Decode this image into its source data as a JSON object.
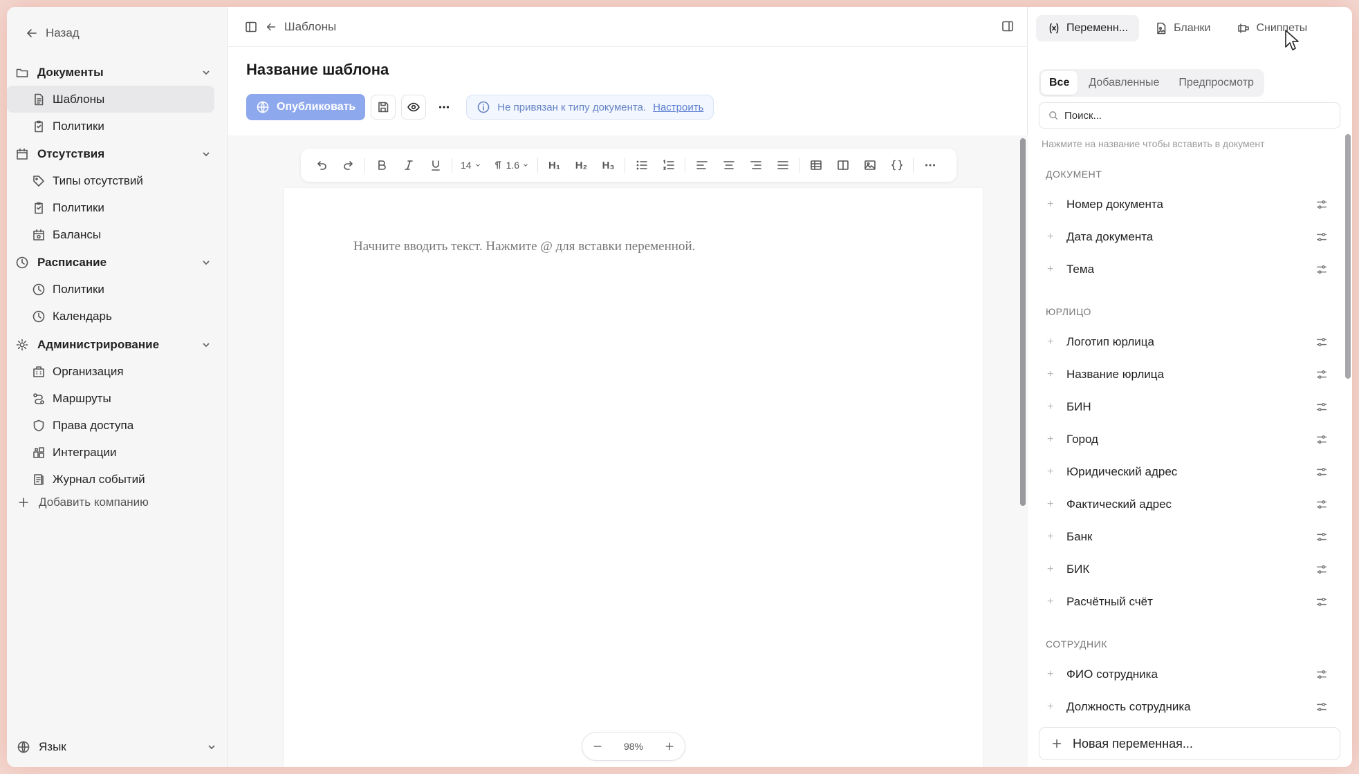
{
  "sidebar": {
    "back_label": "Назад",
    "groups": [
      {
        "label": "Документы",
        "items": [
          {
            "label": "Шаблоны",
            "active": true
          },
          {
            "label": "Политики"
          }
        ]
      },
      {
        "label": "Отсутствия",
        "items": [
          {
            "label": "Типы отсутствий"
          },
          {
            "label": "Политики"
          },
          {
            "label": "Балансы"
          }
        ]
      },
      {
        "label": "Расписание",
        "items": [
          {
            "label": "Политики"
          },
          {
            "label": "Календарь"
          }
        ]
      },
      {
        "label": "Администрирование",
        "items": [
          {
            "label": "Организация"
          },
          {
            "label": "Маршруты"
          },
          {
            "label": "Права доступа"
          },
          {
            "label": "Интеграции"
          },
          {
            "label": "Журнал событий"
          }
        ]
      }
    ],
    "add_company": "Добавить компанию",
    "language": "Язык"
  },
  "topbar": {
    "breadcrumb": "Шаблоны"
  },
  "editor": {
    "title": "Название шаблона",
    "publish_label": "Опубликовать",
    "info_text": "Не привязан к типу документа.",
    "info_link": "Настроить",
    "font_size": "14",
    "line_height": "1.6",
    "placeholder": "Начните вводить текст. Нажмите @ для вставки переменной.",
    "zoom": "98%",
    "heading_labels": [
      "H₁",
      "H₂",
      "H₃"
    ]
  },
  "right_panel": {
    "tabs": [
      {
        "label": "Переменн...",
        "active": true
      },
      {
        "label": "Бланки"
      },
      {
        "label": "Сниппеты"
      }
    ],
    "subtabs": [
      {
        "label": "Все",
        "active": true
      },
      {
        "label": "Добавленные"
      },
      {
        "label": "Предпросмотр"
      }
    ],
    "search_placeholder": "Поиск...",
    "hint": "Нажмите на название чтобы вставить в документ",
    "sections": [
      {
        "title": "ДОКУМЕНТ",
        "items": [
          "Номер документа",
          "Дата документа",
          "Тема"
        ]
      },
      {
        "title": "ЮРЛИЦО",
        "items": [
          "Логотип юрлица",
          "Название юрлица",
          "БИН",
          "Город",
          "Юридический адрес",
          "Фактический адрес",
          "Банк",
          "БИК",
          "Расчётный счёт"
        ]
      },
      {
        "title": "СОТРУДНИК",
        "items": [
          "ФИО сотрудника",
          "Должность сотрудника"
        ]
      }
    ],
    "new_variable": "Новая переменная..."
  },
  "colors": {
    "accent": "#8ea8ee",
    "info_bg": "#f2f6fe",
    "info_text": "#6583c4"
  }
}
